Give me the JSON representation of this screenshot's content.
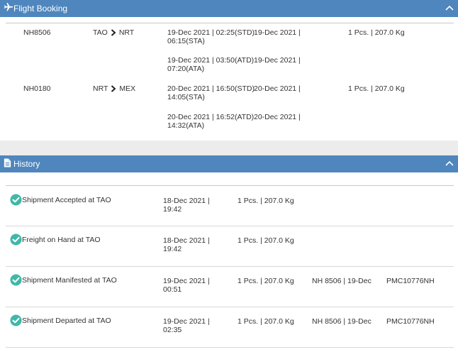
{
  "flight_booking": {
    "title": "Flight Booking",
    "flights": [
      {
        "flight_no": "NH8506",
        "origin": "TAO",
        "destination": "NRT",
        "schedule": "19-Dec 2021 | 02:25(STD)",
        "schedule_cont": "06:15(STA)",
        "schedule_date": "19-Dec 2021 |",
        "actual": "19-Dec 2021 | 03:50(ATD)",
        "actual_cont": "07:20(ATA)",
        "actual_date": "19-Dec 2021 |",
        "pieces": "1 Pcs. | 207.0 Kg"
      },
      {
        "flight_no": "NH0180",
        "origin": "NRT",
        "destination": "MEX",
        "schedule": "20-Dec 2021 | 16:50(STD)",
        "schedule_cont": "14:05(STA)",
        "schedule_date": "20-Dec 2021 |",
        "actual": "20-Dec 2021 | 16:52(ATD)",
        "actual_cont": "14:32(ATA)",
        "actual_date": "20-Dec 2021 |",
        "pieces": "1 Pcs. | 207.0 Kg"
      }
    ]
  },
  "history": {
    "title": "History",
    "events": [
      {
        "status": "Shipment Accepted at TAO",
        "date": "18-Dec 2021 |",
        "time": "19:42",
        "pieces": "1 Pcs. | 207.0 Kg",
        "flight": "",
        "uld": ""
      },
      {
        "status": "Freight on Hand at TAO",
        "date": "18-Dec 2021 |",
        "time": "19:42",
        "pieces": "1 Pcs. | 207.0 Kg",
        "flight": "",
        "uld": ""
      },
      {
        "status": "Shipment Manifested at TAO",
        "date": "19-Dec 2021 |",
        "time": "00:51",
        "pieces": "1 Pcs. | 207.0 Kg",
        "flight": "NH 8506 | 19-Dec",
        "uld": "PMC10776NH"
      },
      {
        "status": "Shipment Departed at TAO",
        "date": "19-Dec 2021 |",
        "time": "02:35",
        "pieces": "1 Pcs. | 207.0 Kg",
        "flight": "NH 8506 | 19-Dec",
        "uld": "PMC10776NH"
      }
    ]
  },
  "icons": {
    "flight_booking": "airplane-icon",
    "history": "document-icon",
    "collapse": "chevron-up-icon",
    "route_arrow": "chevron-right-icon",
    "status": "check-circle-icon"
  },
  "colors": {
    "header": "#4f86bd",
    "check": "#3fb8a8"
  }
}
